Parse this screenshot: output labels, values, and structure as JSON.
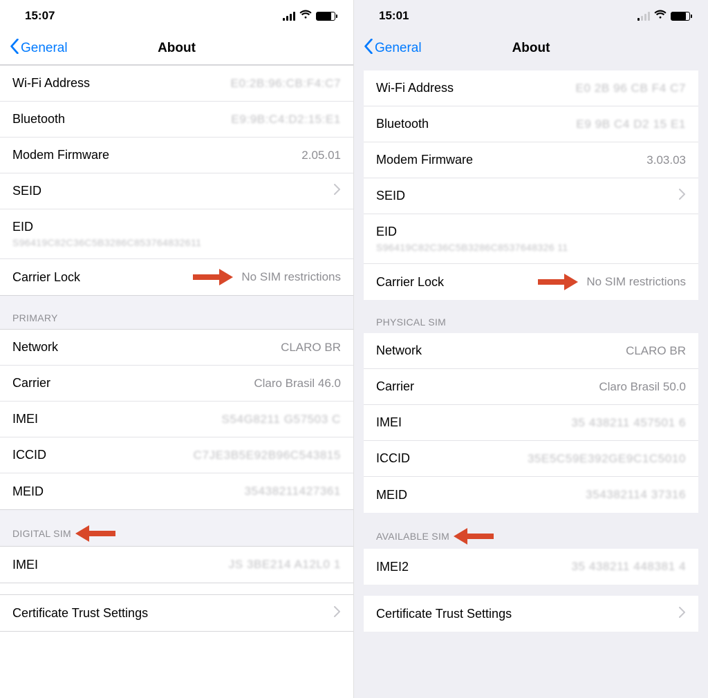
{
  "left": {
    "status_time": "15:07",
    "back_label": "General",
    "title": "About",
    "rows_top": [
      {
        "label": "Wi-Fi Address",
        "value": "E0:2B:96:CB:F4:C7",
        "blur": true
      },
      {
        "label": "Bluetooth",
        "value": "E9:9B:C4:D2:15:E1",
        "blur": true
      },
      {
        "label": "Modem Firmware",
        "value": "2.05.01",
        "blur": false
      },
      {
        "label": "SEID",
        "value": "",
        "chevron": true
      },
      {
        "label": "EID",
        "value": "S96419C82C36C5B3286C853764832611",
        "tall": true,
        "blur": true
      },
      {
        "label": "Carrier Lock",
        "value": "No SIM restrictions",
        "arrow": true
      }
    ],
    "section_primary_title": "PRIMARY",
    "rows_primary": [
      {
        "label": "Network",
        "value": "CLARO BR"
      },
      {
        "label": "Carrier",
        "value": "Claro Brasil 46.0"
      },
      {
        "label": "IMEI",
        "value": "S54G8211 G57503 C",
        "blur": true
      },
      {
        "label": "ICCID",
        "value": "C7JE3B5E92B96C543815",
        "blur": true
      },
      {
        "label": "MEID",
        "value": "35438211427361",
        "blur": true
      }
    ],
    "section_digital_title": "DIGITAL SIM",
    "rows_digital": [
      {
        "label": "IMEI",
        "value": "JS 3BE214 A12L0 1",
        "blur": true
      }
    ],
    "cert_label": "Certificate Trust Settings"
  },
  "right": {
    "status_time": "15:01",
    "back_label": "General",
    "title": "About",
    "rows_top": [
      {
        "label": "Wi-Fi Address",
        "value": "E0 2B 96 CB F4 C7",
        "blur": true
      },
      {
        "label": "Bluetooth",
        "value": "E9 9B C4 D2 15 E1",
        "blur": true
      },
      {
        "label": "Modem Firmware",
        "value": "3.03.03",
        "blur": false
      },
      {
        "label": "SEID",
        "value": "",
        "chevron": true
      },
      {
        "label": "EID",
        "value": "S96419C82C36C5B3286C8537648326 11",
        "tall": true,
        "blur": true
      },
      {
        "label": "Carrier Lock",
        "value": "No SIM restrictions",
        "arrow": true
      }
    ],
    "section_primary_title": "PHYSICAL SIM",
    "rows_primary": [
      {
        "label": "Network",
        "value": "CLARO BR"
      },
      {
        "label": "Carrier",
        "value": "Claro Brasil 50.0"
      },
      {
        "label": "IMEI",
        "value": "35 438211 457501 6",
        "blur": true
      },
      {
        "label": "ICCID",
        "value": "35E5C59E392GE9C1C5010",
        "blur": true
      },
      {
        "label": "MEID",
        "value": "354382114 37316",
        "blur": true
      }
    ],
    "section_digital_title": "AVAILABLE SIM",
    "rows_digital": [
      {
        "label": "IMEI2",
        "value": "35 438211 448381 4",
        "blur": true
      }
    ],
    "cert_label": "Certificate Trust Settings"
  }
}
